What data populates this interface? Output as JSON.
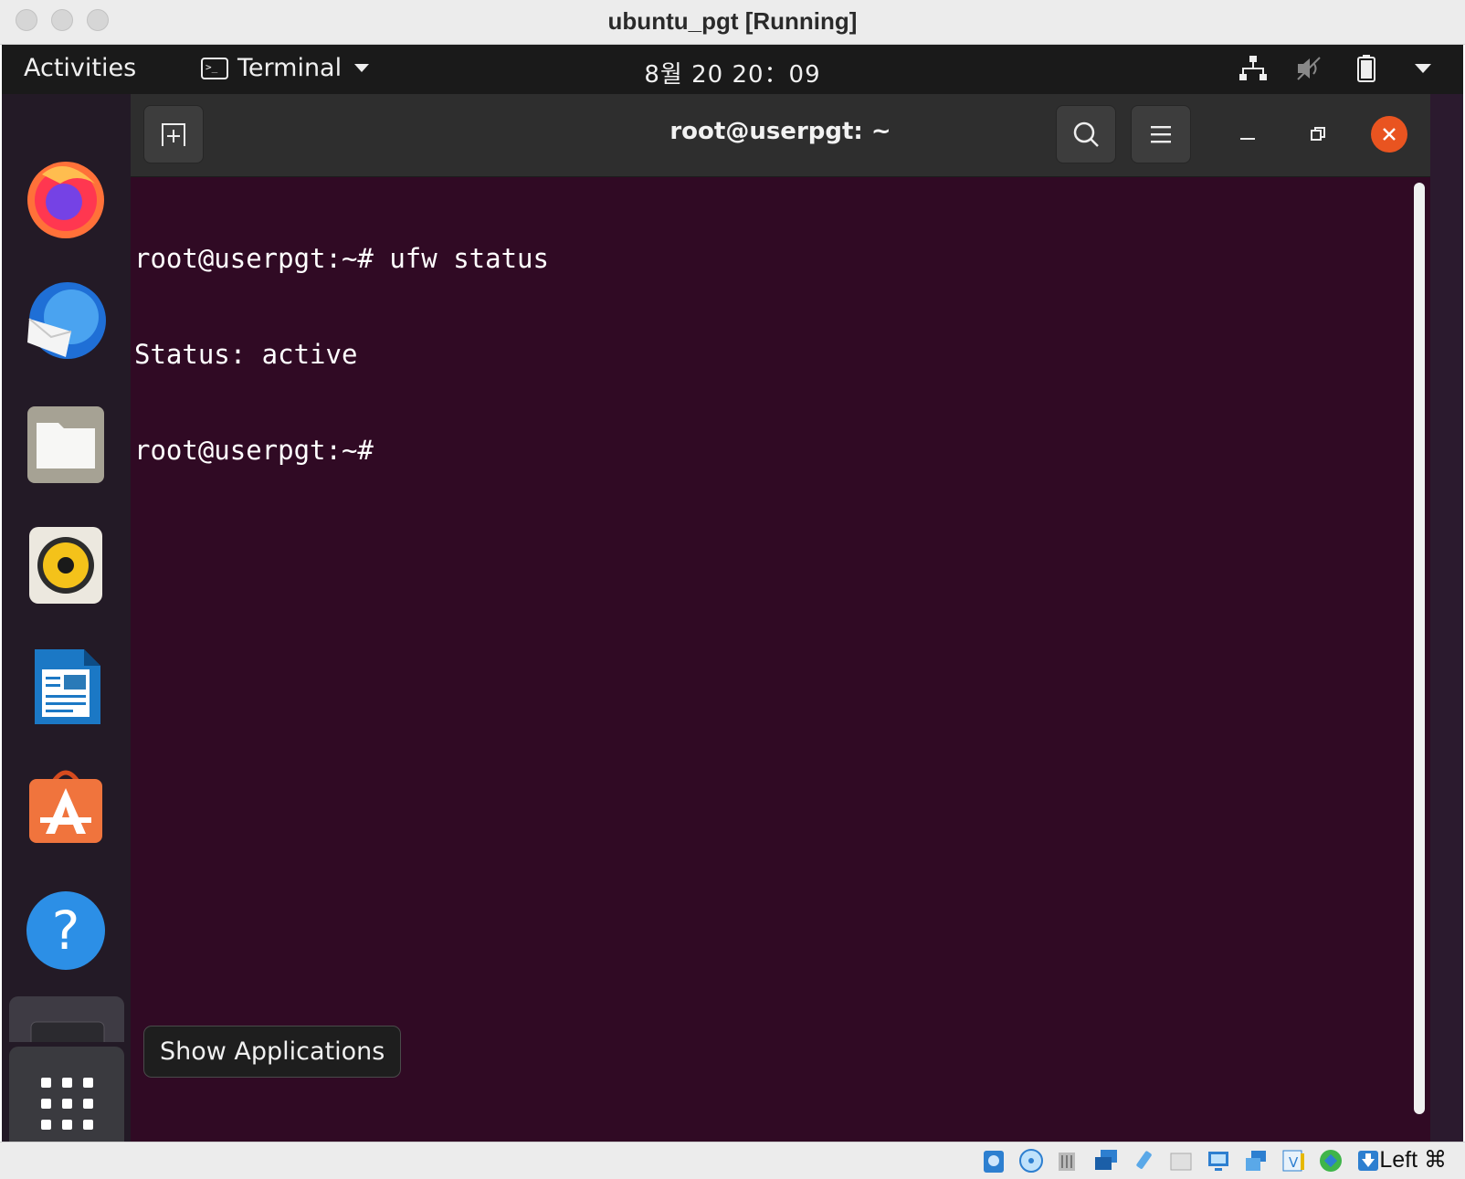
{
  "host_window": {
    "title": "ubuntu_pgt [Running]"
  },
  "topbar": {
    "activities": "Activities",
    "app_menu_label": "Terminal",
    "clock": "8월 20  20：09",
    "tray_icons": [
      "network-wired-icon",
      "volume-muted-icon",
      "battery-icon",
      "system-menu-arrow-icon"
    ]
  },
  "dock": {
    "apps": [
      "firefox-icon",
      "thunderbird-icon",
      "files-icon",
      "rhythmbox-icon",
      "libreoffice-writer-icon",
      "ubuntu-software-icon",
      "help-icon"
    ],
    "running_app": "terminal-icon",
    "show_apps_icon": "app-grid-icon"
  },
  "terminal": {
    "title": "root@userpgt: ~",
    "lines": [
      "root@userpgt:~# ufw status",
      "Status: active",
      "root@userpgt:~#"
    ],
    "colors": {
      "background": "#300a24",
      "text": "#ffffff",
      "close": "#e95420"
    }
  },
  "tooltip": {
    "text": "Show Applications"
  },
  "vbox_status": {
    "icons": [
      "hard-disk-icon",
      "optical-drive-icon",
      "audio-icon",
      "network-icon",
      "usb-icon",
      "shared-folders-icon",
      "display-icon",
      "screen-capture-icon",
      "video-capture-icon",
      "cpu-icon",
      "mouse-integration-icon"
    ],
    "host_key": "Left ⌘"
  }
}
